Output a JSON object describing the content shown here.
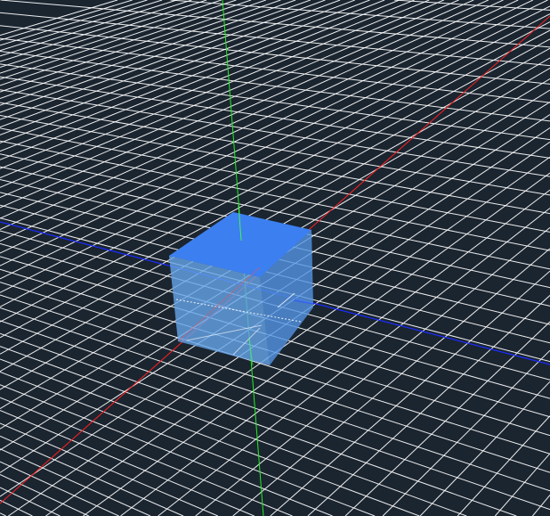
{
  "viewport": {
    "background_color": "#1b2530",
    "grid_color": "#ffffff",
    "grid_visible": true
  },
  "axes": {
    "x_axis_color": "#ff2020",
    "y_axis_color": "#22ee22",
    "z_axis_color": "#1a2cff"
  },
  "object": {
    "type": "cube",
    "top_face_color": "#3c7ff0",
    "side_face_color": "#5ea2ee",
    "selected": false
  }
}
